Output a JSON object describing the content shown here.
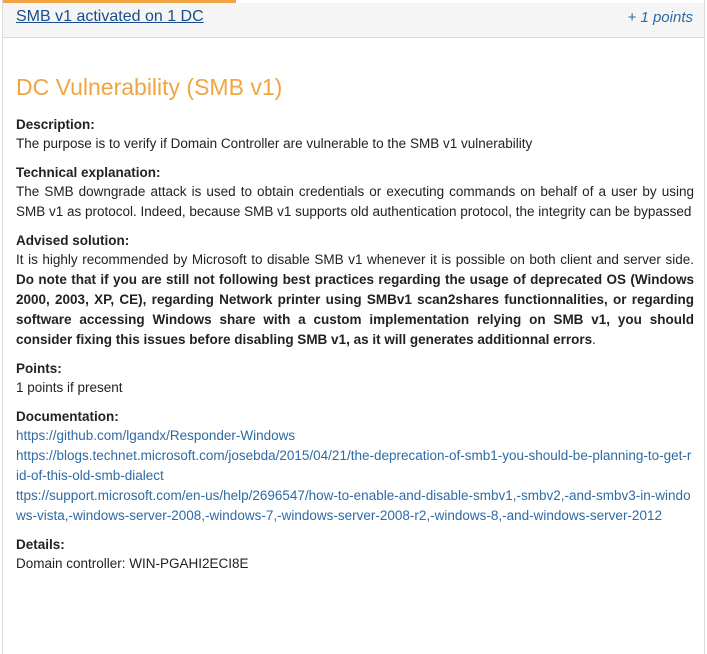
{
  "header": {
    "link_label": "SMB v1 activated on 1 DC",
    "points": "+ 1 points"
  },
  "title": "DC Vulnerability (SMB v1)",
  "description": {
    "label": "Description:",
    "text": "The purpose is to verify if Domain Controller are vulnerable to the SMB v1 vulnerability"
  },
  "technical": {
    "label": "Technical explanation:",
    "text": "The SMB downgrade attack is used to obtain credentials or executing commands on behalf of a user by using SMB v1 as protocol. Indeed, because SMB v1 supports old authentication protocol, the integrity can be bypassed"
  },
  "advised": {
    "label": "Advised solution:",
    "text_plain": "It is highly recommended by Microsoft to disable SMB v1 whenever it is possible on both client and server side. ",
    "text_bold": "Do note that if you are still not following best practices regarding the usage of deprecated OS (Windows 2000, 2003, XP, CE), regarding Network printer using SMBv1 scan2shares functionnalities, or regarding software accessing Windows share with a custom implementation relying on SMB v1, you should consider fixing this issues before disabling SMB v1, as it will generates additionnal errors",
    "text_end": "."
  },
  "points": {
    "label": "Points:",
    "text": "1 points if present"
  },
  "documentation": {
    "label": "Documentation:",
    "links": [
      "https://github.com/lgandx/Responder-Windows",
      "https://blogs.technet.microsoft.com/josebda/2015/04/21/the-deprecation-of-smb1-you-should-be-planning-to-get-rid-of-this-old-smb-dialect",
      "ttps://support.microsoft.com/en-us/help/2696547/how-to-enable-and-disable-smbv1,-smbv2,-and-smbv3-in-windows-vista,-windows-server-2008,-windows-7,-windows-server-2008-r2,-windows-8,-and-windows-server-2012"
    ]
  },
  "details": {
    "label": "Details:",
    "text": "Domain controller: WIN-PGAHI2ECI8E"
  },
  "colors": {
    "accent": "#f0a542",
    "link": "#2f6aa5",
    "header_link": "#1a4d8c",
    "header_bg": "#f5f5f5"
  }
}
